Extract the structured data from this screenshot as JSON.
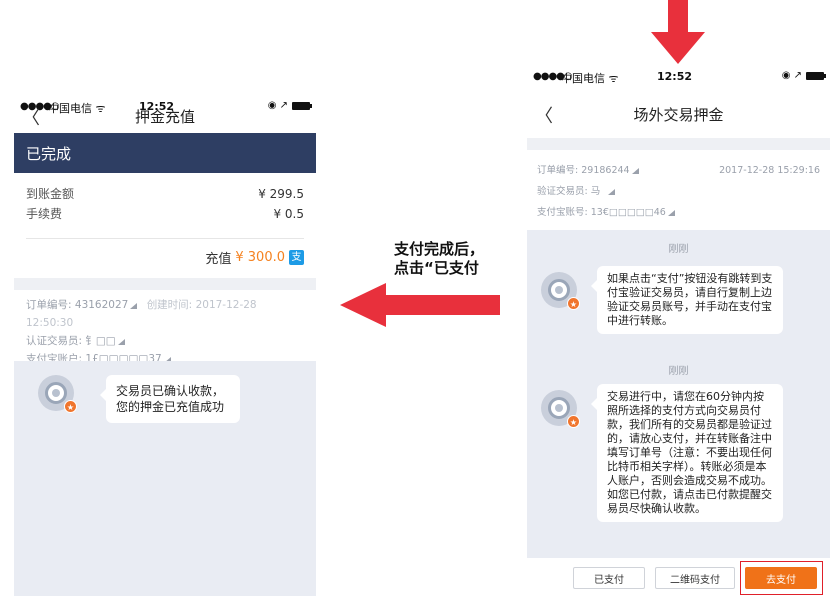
{
  "left_phone": {
    "status": {
      "dots": "●●●●○",
      "carrier": "中国电信 ᯤ",
      "time": "12:52",
      "icons": "◉ ↗"
    },
    "nav": {
      "back": "〈",
      "title": "押金充值"
    },
    "header": {
      "status": "已完成"
    },
    "amounts": [
      {
        "label": "到账金额",
        "value": "¥ 299.5"
      },
      {
        "label": "手续费",
        "value": "¥ 0.5"
      }
    ],
    "recharge": {
      "label": "充值",
      "amount": "¥ 300.0",
      "alipay_icon": "支"
    },
    "order": {
      "order_no_label": "订单编号: ",
      "order_no": "43162027",
      "created_label": "创建时间: ",
      "created": "2017-12-28 12:50:30",
      "trader_label": "认证交易员: ",
      "trader": "钅□□",
      "alipay_label": "支付宝账户: ",
      "alipay": "1£□□□□□37"
    },
    "chat": {
      "message": "交易员已确认收款，您的押金已充值成功"
    }
  },
  "annotation": {
    "line1": "支付完成后，",
    "line2": "点击“已支付"
  },
  "right_phone": {
    "status": {
      "dots": "●●●●○",
      "carrier": "中国电信 ᯤ",
      "time": "12:52",
      "icons": "◉ ↗"
    },
    "nav": {
      "back": "〈",
      "title": "场外交易押金"
    },
    "order": {
      "order_no_label": "订单编号: ",
      "order_no": "29186244",
      "date": "2017-12-28 15:29:16",
      "trader_label": "验证交易员: ",
      "trader": "马",
      "alipay_label": "支付宝账号: ",
      "alipay": "13€□□□□□46"
    },
    "chat": [
      {
        "time": "刚刚",
        "message": "如果点击“支付”按钮没有跳转到支付宝验证交易员，请自行复制上边验证交易员账号，并手动在支付宝中进行转账。"
      },
      {
        "time": "刚刚",
        "message": "交易进行中，请您在60分钟内按照所选择的支付方式向交易员付款，我们所有的交易员都是验证过的，请放心支付，并在转账备注中填写订单号（注意：不要出现任何比特币相关字样）。转账必须是本人账户，否则会造成交易不成功。如您已付款，请点击已付款提醒交易员尽快确认收款。"
      }
    ],
    "buttons": {
      "paid": "已支付",
      "qr_pay": "二维码支付",
      "go_pay": "去支付"
    }
  },
  "colors": {
    "header_bg": "#2e3e63",
    "accent_orange": "#f07218",
    "arrow_red": "#e8303c",
    "highlight_red": "#e0202a"
  }
}
